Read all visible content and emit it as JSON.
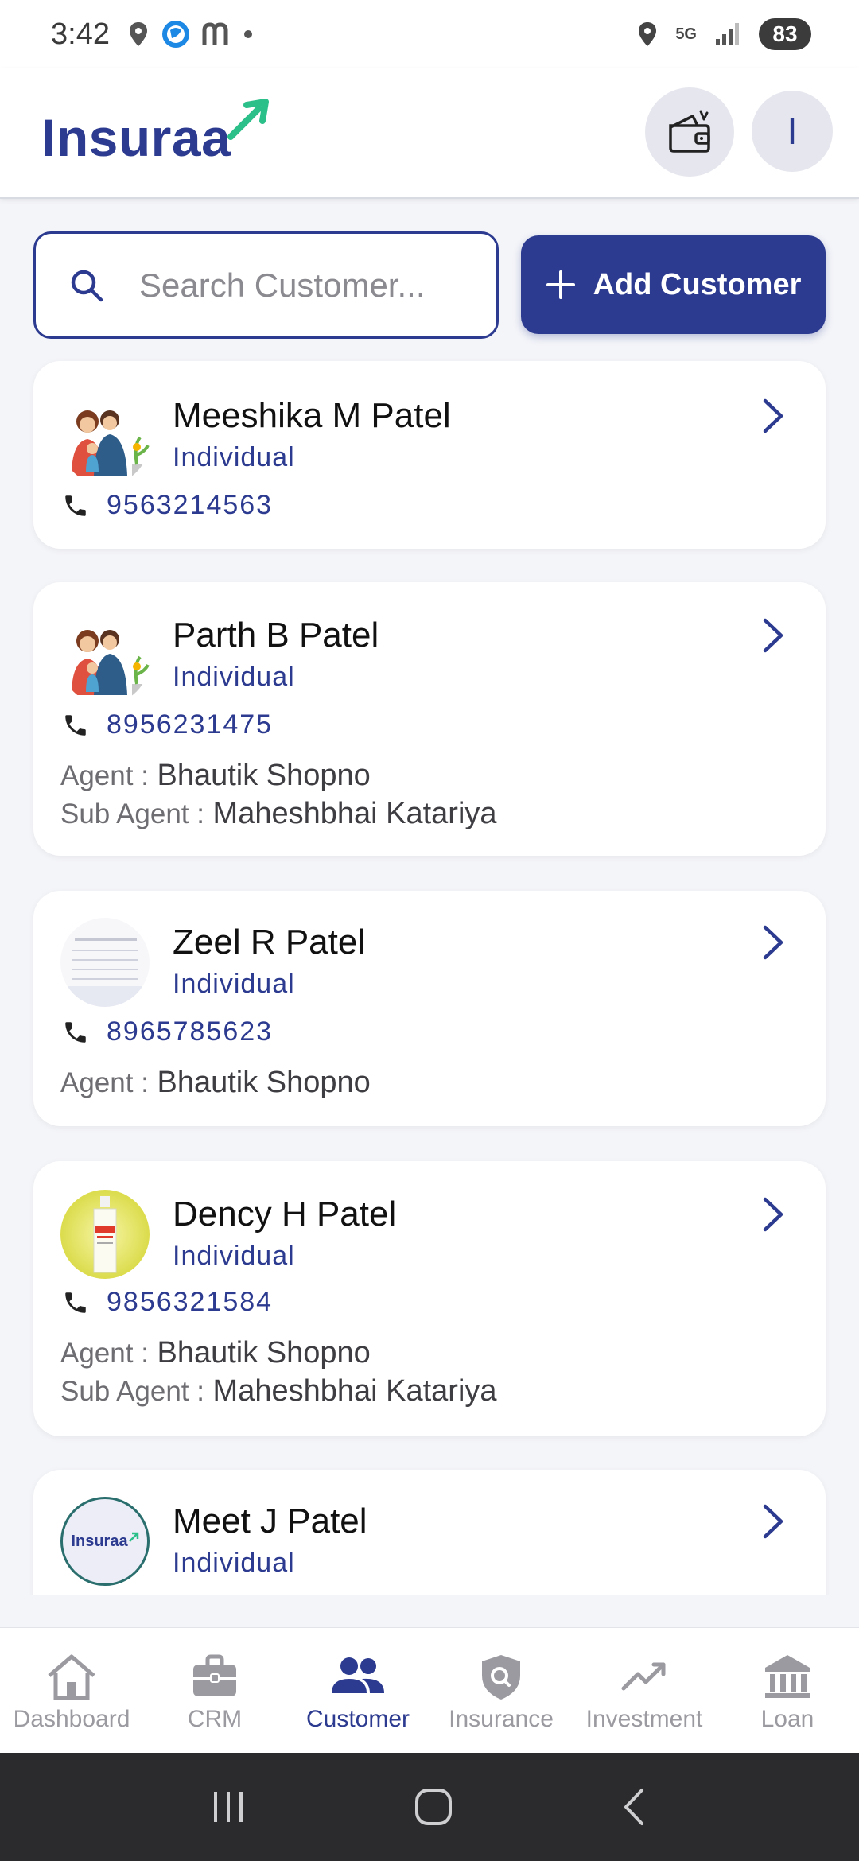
{
  "status_bar": {
    "time": "3:42",
    "network": "5G",
    "battery": "83"
  },
  "header": {
    "logo_text": "Insuraa",
    "avatar_initial": "I"
  },
  "search": {
    "placeholder": "Search Customer..."
  },
  "add_button": {
    "label": "Add Customer"
  },
  "customers": [
    {
      "name": "Meeshika M Patel",
      "type": "Individual",
      "phone": "9563214563"
    },
    {
      "name": "Parth B Patel",
      "type": "Individual",
      "phone": "8956231475",
      "agent_label": "Agent :",
      "agent": "Bhautik Shopno",
      "sub_agent_label": "Sub Agent :",
      "sub_agent": "Maheshbhai Katariya"
    },
    {
      "name": "Zeel R Patel",
      "type": "Individual",
      "phone": "8965785623",
      "agent_label": "Agent :",
      "agent": "Bhautik Shopno"
    },
    {
      "name": "Dency H Patel",
      "type": "Individual",
      "phone": "9856321584",
      "agent_label": "Agent :",
      "agent": "Bhautik Shopno",
      "sub_agent_label": "Sub Agent :",
      "sub_agent": "Maheshbhai Katariya"
    },
    {
      "name": "Meet J Patel",
      "type": "Individual",
      "avatar_logo_text": "Insuraa"
    }
  ],
  "bottom_nav": {
    "items": [
      {
        "label": "Dashboard",
        "icon": "home-icon"
      },
      {
        "label": "CRM",
        "icon": "briefcase-icon"
      },
      {
        "label": "Customer",
        "icon": "people-icon",
        "active": true
      },
      {
        "label": "Insurance",
        "icon": "shield-icon"
      },
      {
        "label": "Investment",
        "icon": "trend-icon"
      },
      {
        "label": "Loan",
        "icon": "bank-icon"
      }
    ]
  },
  "colors": {
    "brand": "#2c3a8f",
    "accent_green": "#2bbf8a",
    "background": "#f4f5f9"
  }
}
